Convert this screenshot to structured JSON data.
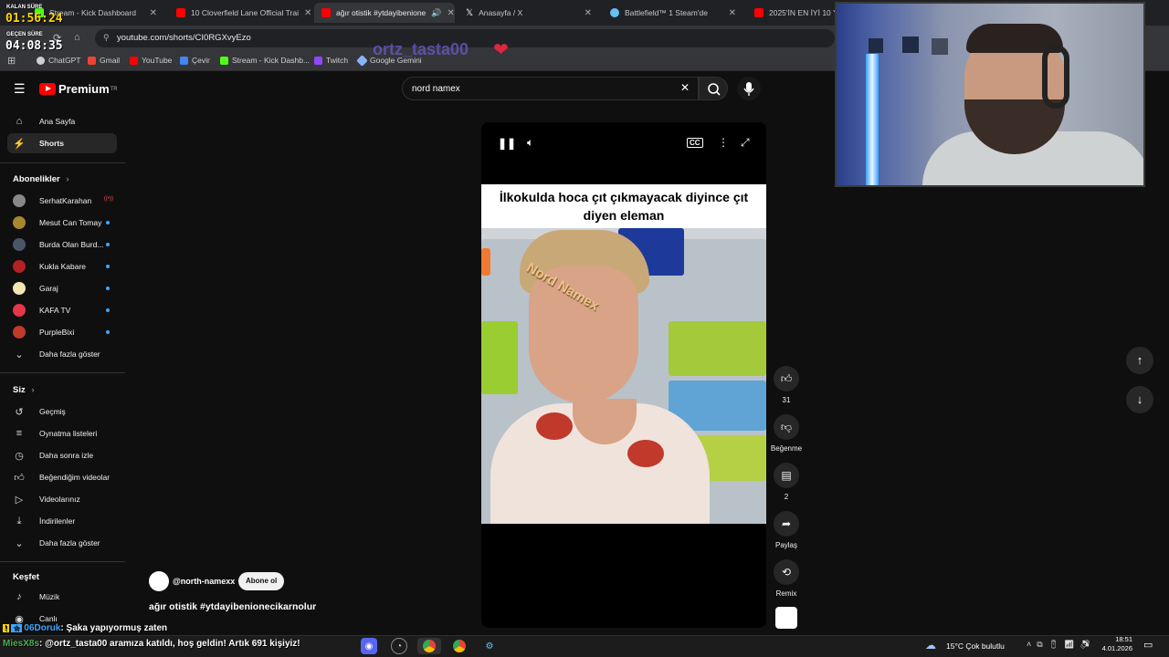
{
  "overlay": {
    "elapsed_label": "KALAN SÜRE",
    "elapsed_time": "01:56:24",
    "passed_label": "GEÇEN SÜRE",
    "passed_time": "04:08:35",
    "username_overlay": "ortz_tasta00",
    "chat_line_1_user": "06Doruk",
    "chat_line_1_text": ": Şaka yapıyormuş zaten",
    "chat_line_2_user": "MiesX8s",
    "chat_line_2_text": ": @ortz_tasta00 aramıza katıldı, hoş geldin! Artık 691 kişiyiz!"
  },
  "browser": {
    "tabs": [
      {
        "title": "Stream - Kick Dashboard",
        "icon": "kick-icon",
        "color": "#53fc18"
      },
      {
        "title": "10 Cloverfield Lane Official Trai",
        "icon": "youtube-icon",
        "color": "#ff0000"
      },
      {
        "title": "ağır otistik #ytdayibenione",
        "icon": "youtube-icon",
        "color": "#ff0000"
      },
      {
        "title": "Anasayfa / X",
        "icon": "x-icon",
        "color": "#ffffff"
      },
      {
        "title": "Battlefield™ 1 Steam'de",
        "icon": "steam-icon",
        "color": "#66c0f4"
      },
      {
        "title": "2025'İN EN İYİ 10 YER",
        "icon": "youtube-icon",
        "color": "#ff0000"
      }
    ],
    "url": "youtube.com/shorts/CI0RGXvyEzo",
    "bookmarks": [
      {
        "label": "ChatGPT",
        "color": "#cfcfcf"
      },
      {
        "label": "Gmail",
        "color": "#ea4335"
      },
      {
        "label": "YouTube",
        "color": "#ff0000"
      },
      {
        "label": "Çevir",
        "color": "#4285f4"
      },
      {
        "label": "Stream - Kick Dashb...",
        "color": "#53fc18"
      },
      {
        "label": "Twitch",
        "color": "#9146ff"
      },
      {
        "label": "Google Gemini",
        "color": "#8ab4f8"
      }
    ]
  },
  "youtube": {
    "logo_text": "Premium",
    "logo_sup": "TR",
    "search_value": "nord namex",
    "sidebar": {
      "home": "Ana Sayfa",
      "shorts": "Shorts",
      "subs_header": "Abonelikler",
      "subscriptions": [
        {
          "name": "SerhatKarahan",
          "color": "#888888",
          "status": "live"
        },
        {
          "name": "Mesut Can Tomay",
          "color": "#a8862e",
          "status": "dot"
        },
        {
          "name": "Burda Olan Burd...",
          "color": "#4a5568",
          "status": "dot"
        },
        {
          "name": "Kukla Kabare",
          "color": "#b22222",
          "status": "dot"
        },
        {
          "name": "Garaj",
          "color": "#f2e6b3",
          "status": "dot"
        },
        {
          "name": "KAFA TV",
          "color": "#e5364a",
          "status": "dot"
        },
        {
          "name": "PurpleBixi",
          "color": "#c0392b",
          "status": "dot"
        }
      ],
      "show_more_1": "Daha fazla göster",
      "you_header": "Siz",
      "you_items": [
        "Geçmiş",
        "Oynatma listeleri",
        "Daha sonra izle",
        "Beğendiğim videolar",
        "Videolarınız",
        "İndirilenler"
      ],
      "show_more_2": "Daha fazla göster",
      "explore_header": "Keşfet",
      "explore_items": [
        "Müzik",
        "Canlı"
      ]
    },
    "video": {
      "caption": "İlkokulda hoca çıt çıkmayacak diyince çıt diyen eleman",
      "watermark": "Nord Namex",
      "channel": "@north-namexx",
      "subscribe": "Abone ol",
      "title": "ağır otistik #ytdayibenionecikarnolur",
      "likes": "31",
      "dislike_label": "Beğenme",
      "comments": "2",
      "share_label": "Paylaş",
      "remix_label": "Remix"
    }
  },
  "taskbar": {
    "weather": "15°C  Çok bulutlu",
    "time": "18:51",
    "date": "4.01.2026"
  }
}
